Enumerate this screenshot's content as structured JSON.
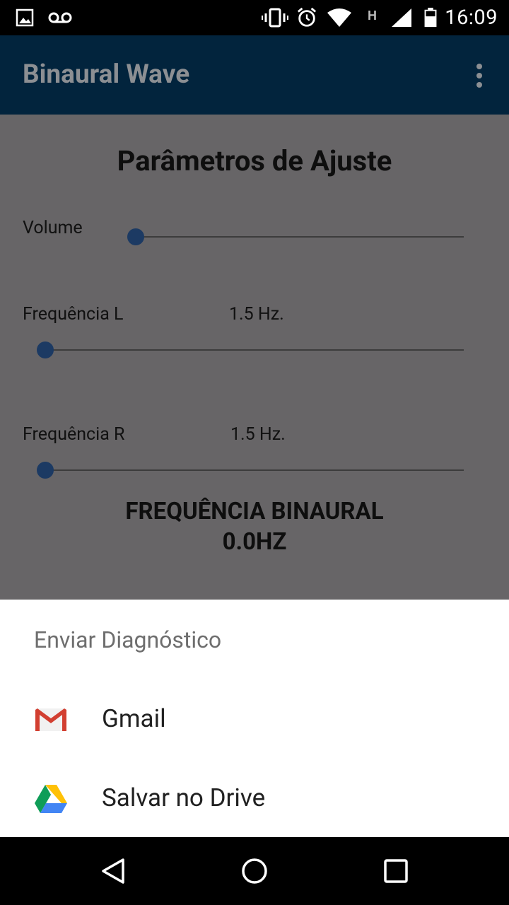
{
  "status_bar": {
    "time": "16:09",
    "icons": [
      "image-icon",
      "voicemail-icon",
      "vibrate-icon",
      "alarm-icon",
      "wifi-icon",
      "signal-h-icon",
      "signal-icon",
      "battery-icon"
    ]
  },
  "app_bar": {
    "title": "Binaural Wave",
    "menu_icon": "more-vert-icon"
  },
  "content": {
    "heading": "Parâmetros de Ajuste",
    "volume": {
      "label": "Volume",
      "value": 0.0
    },
    "freq_l": {
      "label": "Frequência L",
      "display": "1.5 Hz.",
      "value": 0.0
    },
    "freq_r": {
      "label": "Frequência R",
      "display": "1.5 Hz.",
      "value": 0.0
    },
    "binaural_label": "FREQUÊNCIA BINAURAL",
    "binaural_value": "0.0HZ"
  },
  "share_sheet": {
    "title": "Enviar Diagnóstico",
    "items": [
      {
        "label": "Gmail",
        "icon": "gmail-icon"
      },
      {
        "label": "Salvar no Drive",
        "icon": "google-drive-icon"
      }
    ]
  },
  "nav_bar": {
    "buttons": [
      "back-icon",
      "home-icon",
      "recents-icon"
    ]
  },
  "colors": {
    "app_bar": "#02243d",
    "overlay_content": "#676567",
    "slider_thumb": "#1c3a63",
    "sheet_bg": "#ffffff"
  }
}
